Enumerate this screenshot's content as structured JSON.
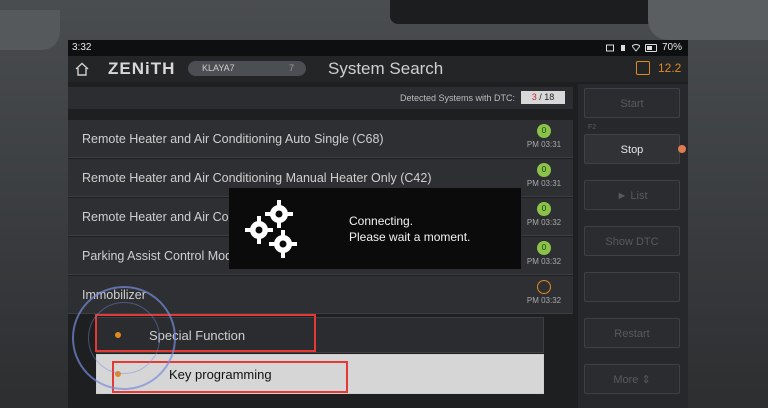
{
  "statusbar": {
    "time": "3:32",
    "battery": "70%"
  },
  "header": {
    "brand": "ZENiTH",
    "vin": "KLAYA7",
    "vin_tail": "7",
    "title": "System Search",
    "voltage": "12.2"
  },
  "dtc": {
    "label": "Detected Systems with DTC:",
    "count": "3",
    "separator": " / ",
    "total": "18"
  },
  "systems": [
    {
      "label": "Remote Heater and Air Conditioning Auto Single (C68)",
      "code_count": "0",
      "time": "PM 03:31"
    },
    {
      "label": "Remote Heater and Air Conditioning Manual Heater Only (C42)",
      "code_count": "0",
      "time": "PM 03:31"
    },
    {
      "label": "Remote Heater and Air Conditioning",
      "code_count": "0",
      "time": "PM 03:32"
    },
    {
      "label": "Parking Assist Control Module",
      "code_count": "0",
      "time": "PM 03:32"
    },
    {
      "label": "Immobilizer",
      "code_count": "",
      "time": "PM 03:32"
    }
  ],
  "sub_functions": {
    "special_function": "Special Function",
    "key_programming": "Key programming"
  },
  "right_panel": {
    "start": "Start",
    "stop": "Stop",
    "list": "► List",
    "show_dtc": "Show DTC",
    "restart": "Restart",
    "more": "More ⇕",
    "stop_fkey": "F2"
  },
  "modal": {
    "line1": "Connecting.",
    "line2": "Please wait a moment."
  },
  "colors": {
    "accent_orange": "#e08a1e",
    "status_green": "#8bc34a",
    "highlight_red": "#e53935"
  }
}
